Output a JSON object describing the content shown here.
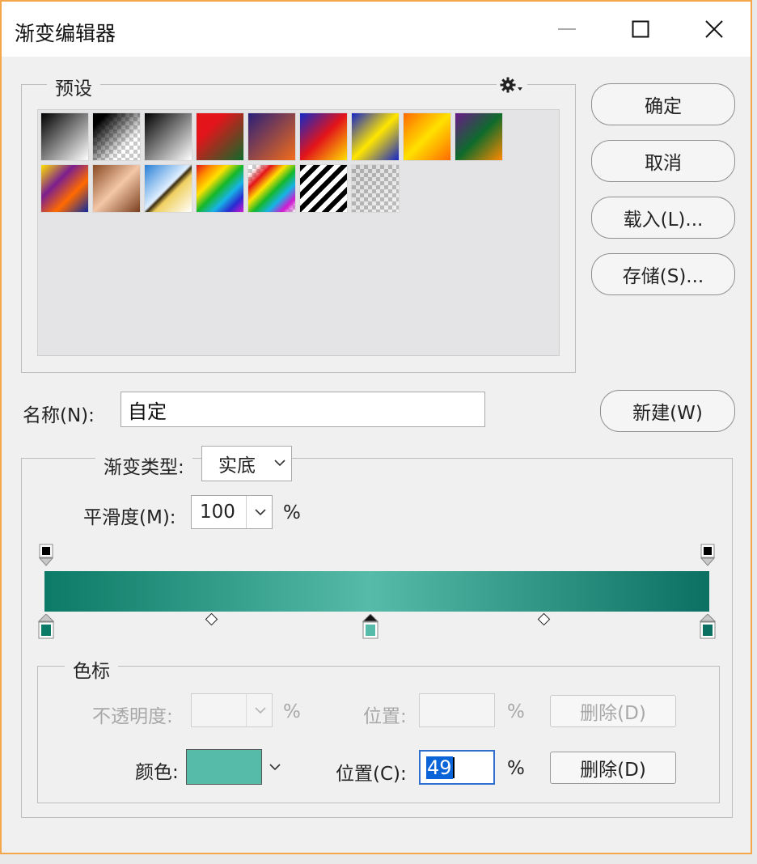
{
  "window": {
    "title": "渐变编辑器",
    "minimize_icon": "minimize-icon",
    "maximize_icon": "maximize-icon",
    "close_icon": "close-icon"
  },
  "presets": {
    "legend": "预设",
    "menu_icon": "gear-icon",
    "swatches": [
      {
        "name": "foreground-to-background",
        "css": "linear-gradient(135deg,#000 0%,#fff 100%)"
      },
      {
        "name": "foreground-to-transparent",
        "css": "linear-gradient(135deg,#000 0%,#000 15%,rgba(0,0,0,0) 70%)",
        "checker": true
      },
      {
        "name": "black-white",
        "css": "linear-gradient(135deg,#000 0%,#fff 100%)"
      },
      {
        "name": "red-green",
        "css": "linear-gradient(135deg,#e3141a 30%,#0d6b2a 100%)"
      },
      {
        "name": "violet-orange",
        "css": "linear-gradient(135deg,#2a1f7a 0%,#f36c1a 100%)"
      },
      {
        "name": "blue-red-yellow",
        "css": "linear-gradient(135deg,#1129c9 0%,#e3141a 50%,#ffe100 100%)"
      },
      {
        "name": "blue-yellow-blue",
        "css": "linear-gradient(135deg,#1424c8 0%,#ffe600 50%,#1424c8 100%)"
      },
      {
        "name": "orange-yellow-orange",
        "css": "linear-gradient(135deg,#ff6a00 0%,#ffe100 50%,#ff6a00 100%)"
      },
      {
        "name": "violet-green-orange",
        "css": "linear-gradient(135deg,#6a1a8a 0%,#0e6b2b 50%,#ff8a00 100%)"
      },
      {
        "name": "yellow-violet-orange-blue",
        "css": "linear-gradient(135deg,#ffe100 0%,#7b1f8f 35%,#ff6a00 65%,#0d2aa0 100%)"
      },
      {
        "name": "copper",
        "css": "linear-gradient(135deg,#8a4a24 0%,#f3c7a8 50%,#7a3f1e 100%)"
      },
      {
        "name": "chrome",
        "css": "linear-gradient(135deg,#2a7fd6 0%,#dff0ff 48%,#3a2a10 52%,#f0d060 60%,#fff 100%)"
      },
      {
        "name": "spectrum",
        "css": "linear-gradient(135deg,#e3141a 0%,#ff8a00 17%,#ffe100 33%,#15b82a 50%,#17b3e6 67%,#2a2ad0 83%,#d01ad0 100%)"
      },
      {
        "name": "transparent-rainbow",
        "css": "linear-gradient(135deg,rgba(255,0,0,0) 10%,#e3141a 25%,#ffe100 40%,#15b82a 55%,#17b3e6 70%,#d01ad0 85%,rgba(0,0,0,0) 100%)",
        "checker": true
      },
      {
        "name": "transparent-stripes",
        "css": "repeating-linear-gradient(135deg,#000 0px,#000 6px,#fff 6px,#fff 12px)"
      },
      {
        "name": "neutral-density",
        "css": "linear-gradient(135deg,rgba(0,0,0,0.15) 0%,rgba(0,0,0,0.05) 100%)",
        "checker": true
      }
    ]
  },
  "buttons": {
    "ok": "确定",
    "cancel": "取消",
    "load": "载入(L)...",
    "save": "存储(S)...",
    "new": "新建(W)"
  },
  "name_field": {
    "label": "名称(N):",
    "value": "自定"
  },
  "gradient": {
    "type_label": "渐变类型:",
    "type_value": "实底",
    "smoothness_label": "平滑度(M):",
    "smoothness_value": "100",
    "smoothness_unit": "%",
    "bar_css": "linear-gradient(90deg,#0b7a66 0%,#56bba8 49%,#0b7062 100%)",
    "opacity_stops": [
      {
        "pct": 0,
        "color": "#000000"
      },
      {
        "pct": 100,
        "color": "#000000"
      }
    ],
    "color_stops": [
      {
        "pct": 0,
        "color": "#0b7a66"
      },
      {
        "pct": 49,
        "color": "#56bba8",
        "selected": true
      },
      {
        "pct": 100,
        "color": "#0b7062"
      }
    ],
    "midpoints_pct": [
      25,
      75
    ]
  },
  "stops": {
    "legend": "色标",
    "opacity_label": "不透明度:",
    "opacity_unit": "%",
    "opacity_pos_label": "位置:",
    "opacity_pos_unit": "%",
    "opacity_delete": "删除(D)",
    "color_label": "颜色:",
    "color_value": "#56bba8",
    "color_pos_label": "位置(C):",
    "color_pos_value": "49",
    "color_pos_unit": "%",
    "color_delete": "删除(D)"
  }
}
